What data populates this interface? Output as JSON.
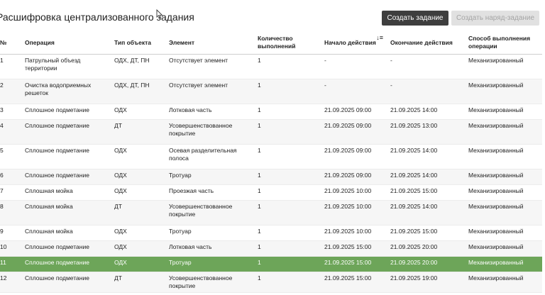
{
  "page": {
    "title": "Расшифровка централизованного задания"
  },
  "toolbar": {
    "create_task_label": "Создать задание",
    "create_order_label": "Создать наряд-задание"
  },
  "table": {
    "columns": [
      "№",
      "Операция",
      "Тип объекта",
      "Элемент",
      "Количество выполнений",
      "Начало действия",
      "Окончание действия",
      "Способ выполнения операции"
    ],
    "sorted_column_icon": "sort-desc-icon",
    "rows": [
      {
        "num": "1",
        "operation": "Патрульный объезд территории",
        "object_type": "ОДХ, ДТ, ПН",
        "element": "Отсутствует элемент",
        "count": "1",
        "start": "-",
        "end": "-",
        "method": "Механизированный"
      },
      {
        "num": "2",
        "operation": "Очистка водоприемных решеток",
        "object_type": "ОДХ, ДТ, ПН",
        "element": "Отсутствует элемент",
        "count": "1",
        "start": "-",
        "end": "-",
        "method": "Механизированный"
      },
      {
        "num": "3",
        "operation": "Сплошное подметание",
        "object_type": "ОДХ",
        "element": "Лотковая часть",
        "count": "1",
        "start": "21.09.2025 09:00",
        "end": "21.09.2025 14:00",
        "method": "Механизированный"
      },
      {
        "num": "4",
        "operation": "Сплошное подметание",
        "object_type": "ДТ",
        "element": "Усовершенствованное покрытие",
        "count": "1",
        "start": "21.09.2025 09:00",
        "end": "21.09.2025 13:00",
        "method": "Механизированный"
      },
      {
        "num": "5",
        "operation": "Сплошное подметание",
        "object_type": "ОДХ",
        "element": "Осевая разделительная полоса",
        "count": "1",
        "start": "21.09.2025 09:00",
        "end": "21.09.2025 14:00",
        "method": "Механизированный"
      },
      {
        "num": "6",
        "operation": "Сплошное подметание",
        "object_type": "ОДХ",
        "element": "Тротуар",
        "count": "1",
        "start": "21.09.2025 09:00",
        "end": "21.09.2025 14:00",
        "method": "Механизированный"
      },
      {
        "num": "7",
        "operation": "Сплошная мойка",
        "object_type": "ОДХ",
        "element": "Проезжая часть",
        "count": "1",
        "start": "21.09.2025 10:00",
        "end": "21.09.2025 15:00",
        "method": "Механизированный"
      },
      {
        "num": "8",
        "operation": "Сплошная мойка",
        "object_type": "ДТ",
        "element": "Усовершенствованное покрытие",
        "count": "1",
        "start": "21.09.2025 10:00",
        "end": "21.09.2025 14:00",
        "method": "Механизированный"
      },
      {
        "num": "9",
        "operation": "Сплошная мойка",
        "object_type": "ОДХ",
        "element": "Тротуар",
        "count": "1",
        "start": "21.09.2025 10:00",
        "end": "21.09.2025 15:00",
        "method": "Механизированный"
      },
      {
        "num": "10",
        "operation": "Сплошное подметание",
        "object_type": "ОДХ",
        "element": "Лотковая часть",
        "count": "1",
        "start": "21.09.2025 15:00",
        "end": "21.09.2025 20:00",
        "method": "Механизированный"
      },
      {
        "num": "11",
        "operation": "Сплошное подметание",
        "object_type": "ОДХ",
        "element": "Тротуар",
        "count": "1",
        "start": "21.09.2025 15:00",
        "end": "21.09.2025 20:00",
        "method": "Механизированный",
        "selected": true
      },
      {
        "num": "12",
        "operation": "Сплошное подметание",
        "object_type": "ДТ",
        "element": "Усовершенствованное покрытие",
        "count": "1",
        "start": "21.09.2025 15:00",
        "end": "21.09.2025 19:00",
        "method": "Механизированный"
      }
    ]
  },
  "colors": {
    "selected_row": "#6da559",
    "primary_button": "#3e3e3e",
    "disabled_button": "#e1e1e1"
  }
}
